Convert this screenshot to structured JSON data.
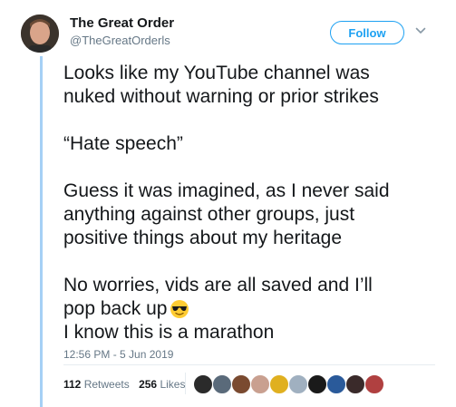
{
  "author": {
    "display_name": "The Great Order",
    "handle": "@TheGreatOrderls",
    "avatar_icon": "user-avatar-photo"
  },
  "follow_button": {
    "label": "Follow",
    "color": "#1da1f2"
  },
  "tweet": {
    "paragraphs": [
      [
        "Looks like my YouTube channel was",
        "nuked without warning or prior strikes"
      ],
      [
        "“Hate speech”"
      ],
      [
        "Guess it was imagined, as I never said",
        "anything against other groups, just",
        "positive things about my heritage"
      ],
      [
        "No worries, vids are all saved and I’ll",
        "pop back up",
        "I know this is a marathon"
      ]
    ],
    "emoji": "smiling-face-with-sunglasses"
  },
  "timestamp": "12:56 PM - 5 Jun 2019",
  "stats": {
    "retweets_count": "112",
    "retweets_label": "Retweets",
    "likes_count": "256",
    "likes_label": "Likes"
  },
  "facepile": {
    "count": 10,
    "colors": [
      "#2b2b2b",
      "#5a6a7a",
      "#7a4a30",
      "#c9a090",
      "#e0b020",
      "#a0b0c0",
      "#1a1a1a",
      "#2a5a9a",
      "#3a2a2a",
      "#b04040"
    ]
  },
  "colors": {
    "text": "#14171a",
    "muted": "#657786",
    "accent": "#1da1f2",
    "thread_line": "#a5d0f5"
  }
}
